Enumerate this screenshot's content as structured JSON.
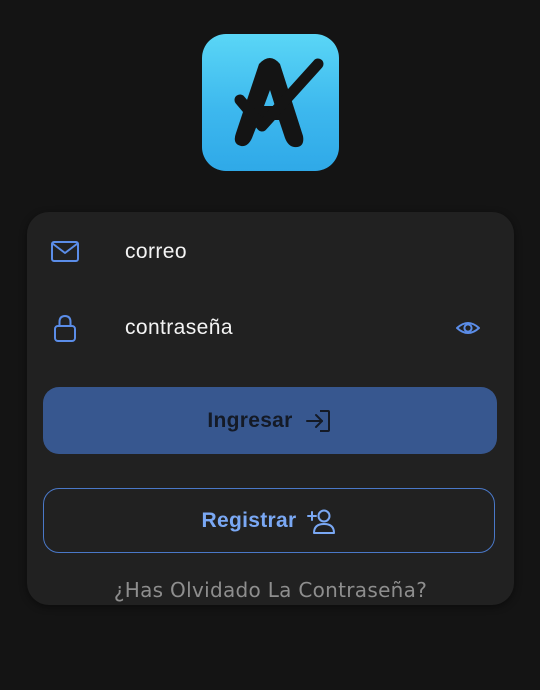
{
  "app": {
    "logo_icon": "app-logo-a-check-icon",
    "logo_gradient": [
      "#5ad6f6",
      "#2fa9e8"
    ]
  },
  "login_form": {
    "email": {
      "icon": "mail-icon",
      "placeholder": "correo",
      "value": ""
    },
    "password": {
      "icon": "lock-icon",
      "placeholder": "contraseña",
      "value": "",
      "toggle_icon": "eye-icon"
    },
    "login_button": {
      "label": "Ingresar",
      "icon": "login-arrow-icon",
      "color": "#37578f"
    },
    "register_button": {
      "label": "Registrar",
      "icon": "add-user-icon",
      "color": "#4a78c8"
    },
    "forgot_password_link": "¿Has Olvidado La Contraseña?"
  },
  "colors": {
    "background": "#141414",
    "card": "#212121",
    "accent": "#5b8de8",
    "text": "#ffffff",
    "muted_text": "#8e8e8e"
  }
}
